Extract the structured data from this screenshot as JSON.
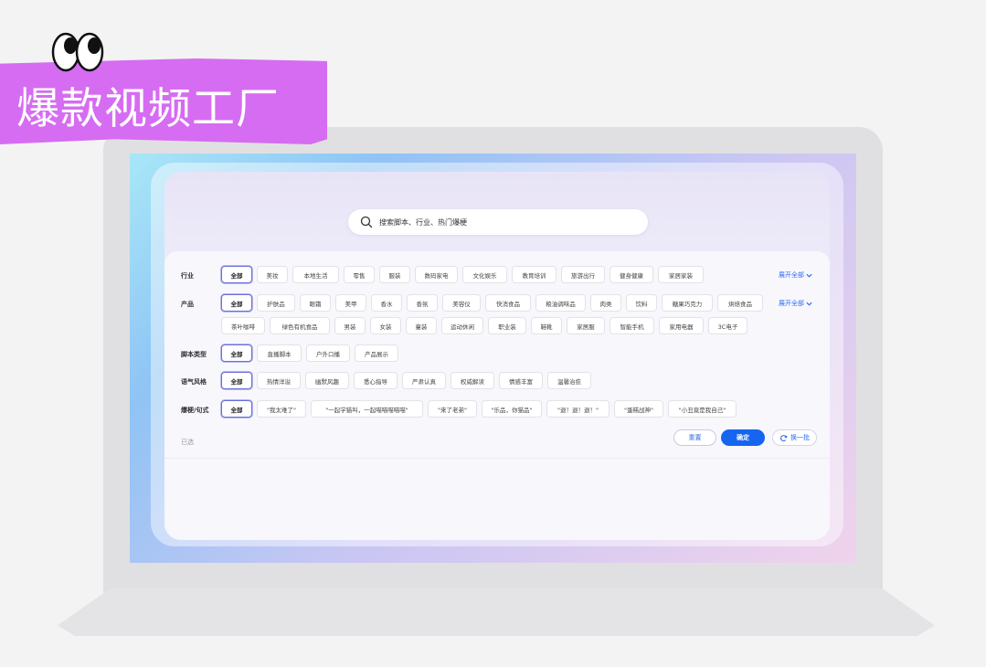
{
  "banner": {
    "title": "爆款视频工厂"
  },
  "search": {
    "placeholder": "搜索脚本、行业、热门爆梗"
  },
  "filters": {
    "industry": {
      "label": "行业",
      "chips": [
        "全部",
        "美妆",
        "本地生活",
        "零售",
        "服装",
        "数码家电",
        "文化娱乐",
        "教育培训",
        "旅游出行",
        "健身健康",
        "家居家装"
      ],
      "expand": "展开全部"
    },
    "product": {
      "label": "产品",
      "chips_row1": [
        "全部",
        "护肤品",
        "眼霜",
        "美甲",
        "香水",
        "香氛",
        "美容仪",
        "快消食品",
        "粮油调味品",
        "肉类",
        "饮料",
        "糖果巧克力",
        "烘焙食品"
      ],
      "chips_row2": [
        "茶叶咖啡",
        "绿色有机食品",
        "男装",
        "女装",
        "童装",
        "运动休闲",
        "职业装",
        "鞋靴",
        "家居服",
        "智能手机",
        "家用电器",
        "3C电子"
      ],
      "expand": "展开全部"
    },
    "script_type": {
      "label": "脚本类型",
      "chips": [
        "全部",
        "直播脚本",
        "户外口播",
        "产品展示"
      ]
    },
    "tone": {
      "label": "语气风格",
      "chips": [
        "全部",
        "热情洋溢",
        "幽默风趣",
        "悉心指导",
        "严肃认真",
        "权威解读",
        "情感丰富",
        "温馨治愈"
      ]
    },
    "meme": {
      "label": "爆梗/句式",
      "chips": [
        "全部",
        "\"我太难了\"",
        "\"一起学猫叫，一起喵喵喵喵喵\"",
        "\"来了老弟\"",
        "\"乐品，你猫品\"",
        "\"退！退！退！\"",
        "\"蛋糕战神\"",
        "\"小丑竟是我自己\""
      ]
    }
  },
  "footer": {
    "selected_label": "已选",
    "reset": "重置",
    "confirm": "确定",
    "swap": "换一批"
  }
}
